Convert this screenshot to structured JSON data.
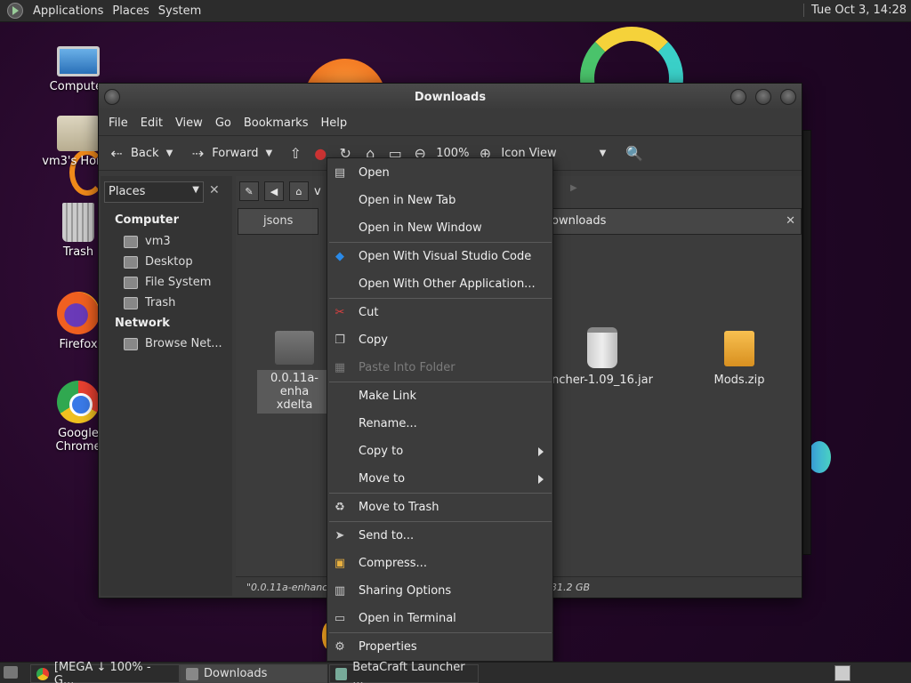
{
  "top_panel": {
    "menus": [
      "Applications",
      "Places",
      "System"
    ],
    "clock": "Tue Oct  3, 14:28"
  },
  "desktop_icons": [
    {
      "label": "Computer",
      "icon": "computer-icon"
    },
    {
      "label": "vm3's Home",
      "icon": "home-folder-icon"
    },
    {
      "label": "Trash",
      "icon": "trash-icon"
    },
    {
      "label": "Firefox",
      "icon": "firefox-icon"
    },
    {
      "label": "Google Chrome",
      "icon": "chrome-icon"
    }
  ],
  "window": {
    "title": "Downloads",
    "menubar": [
      "File",
      "Edit",
      "View",
      "Go",
      "Bookmarks",
      "Help"
    ],
    "toolbar": {
      "back": "Back",
      "forward": "Forward",
      "zoom": "100%",
      "view_mode": "Icon View"
    },
    "sidebar": {
      "selector": "Places",
      "sections": [
        {
          "heading": "Computer",
          "items": [
            "vm3",
            "Desktop",
            "File System",
            "Trash"
          ]
        },
        {
          "heading": "Network",
          "items": [
            "Browse Net..."
          ]
        }
      ]
    },
    "pathbar": {
      "partial_left": "v",
      "partial_right": "a"
    },
    "tabs": {
      "left": "jsons",
      "right": "ownloads"
    },
    "files": [
      {
        "name_line1": "0.0.11a-enha",
        "name_line2": "xdelta",
        "type": "folder",
        "selected": true
      },
      {
        "name": "ncher-1.09_16.jar",
        "type": "jar"
      },
      {
        "name": "Mods.zip",
        "type": "zip"
      }
    ],
    "status": {
      "left": "\"0.0.11a-enhance",
      "right": "31.2 GB"
    }
  },
  "context_menu": {
    "items": [
      {
        "label": "Open",
        "icon": "open-icon"
      },
      {
        "label": "Open in New Tab"
      },
      {
        "label": "Open in New Window"
      },
      {
        "sep": true
      },
      {
        "label": "Open With Visual Studio Code",
        "icon": "vscode-icon"
      },
      {
        "label": "Open With Other Application..."
      },
      {
        "sep": true
      },
      {
        "label": "Cut",
        "icon": "scissors-icon"
      },
      {
        "label": "Copy",
        "icon": "copy-icon"
      },
      {
        "label": "Paste Into Folder",
        "icon": "paste-icon",
        "disabled": true
      },
      {
        "sep": true
      },
      {
        "label": "Make Link"
      },
      {
        "label": "Rename..."
      },
      {
        "label": "Copy to",
        "submenu": true
      },
      {
        "label": "Move to",
        "submenu": true
      },
      {
        "sep": true
      },
      {
        "label": "Move to Trash",
        "icon": "trash-icon"
      },
      {
        "sep": true
      },
      {
        "label": "Send to...",
        "icon": "send-icon"
      },
      {
        "label": "Compress...",
        "icon": "compress-icon"
      },
      {
        "label": "Sharing Options",
        "icon": "share-icon"
      },
      {
        "label": "Open in Terminal",
        "icon": "terminal-icon"
      },
      {
        "sep": true
      },
      {
        "label": "Properties",
        "icon": "properties-icon"
      }
    ]
  },
  "taskbar": {
    "tasks": [
      {
        "label": "[MEGA ↓ 100% - G...",
        "icon": "chrome-icon"
      },
      {
        "label": "Downloads",
        "icon": "folder-icon",
        "active": true
      },
      {
        "label": "BetaCraft Launcher ...",
        "icon": "java-icon"
      }
    ]
  }
}
